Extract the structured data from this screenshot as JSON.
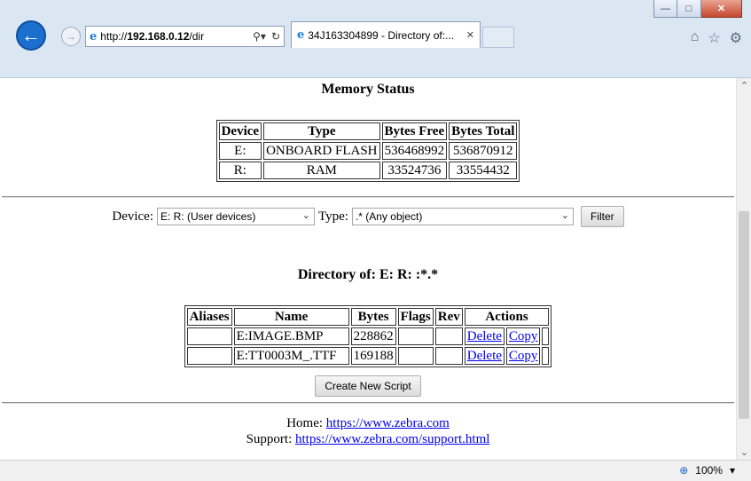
{
  "browser": {
    "address": {
      "prefix": "http://",
      "host": "192.168.0.12",
      "path": "/dir"
    },
    "tab_title": "34J163304899 - Directory of:...",
    "icons": [
      "back-arrow-icon",
      "forward-arrow-icon",
      "ie-logo-icon",
      "search-icon",
      "refresh-icon",
      "tab-close-icon",
      "home-icon",
      "favorites-star-icon",
      "gear-icon",
      "minimize-icon",
      "maximize-icon",
      "close-icon"
    ],
    "zoom_label": "100%"
  },
  "memory": {
    "title": "Memory Status",
    "headers": [
      "Device",
      "Type",
      "Bytes Free",
      "Bytes Total"
    ],
    "rows": [
      [
        "E:",
        "ONBOARD FLASH",
        "536468992",
        "536870912"
      ],
      [
        "R:",
        "RAM",
        "33524736",
        "33554432"
      ]
    ]
  },
  "filter": {
    "device_label": "Device:",
    "device_value": "E: R: (User devices)",
    "type_label": "Type:",
    "type_value": ".* (Any object)",
    "button": "Filter"
  },
  "directory": {
    "title": "Directory of: E: R: :*.*",
    "headers": [
      "Aliases",
      "Name",
      "Bytes",
      "Flags",
      "Rev",
      "Actions"
    ],
    "rows": [
      {
        "aliases": "",
        "name": "E:IMAGE.BMP",
        "bytes": "228862",
        "flags": "",
        "rev": "",
        "delete": "Delete",
        "copy": "Copy"
      },
      {
        "aliases": "",
        "name": "E:TT0003M_.TTF",
        "bytes": "169188",
        "flags": "",
        "rev": "",
        "delete": "Delete",
        "copy": "Copy"
      }
    ],
    "create_button": "Create New Script"
  },
  "footer": {
    "home_label": "Home:",
    "home_link": "https://www.zebra.com",
    "support_label": "Support:",
    "support_link": "https://www.zebra.com/support.html"
  }
}
